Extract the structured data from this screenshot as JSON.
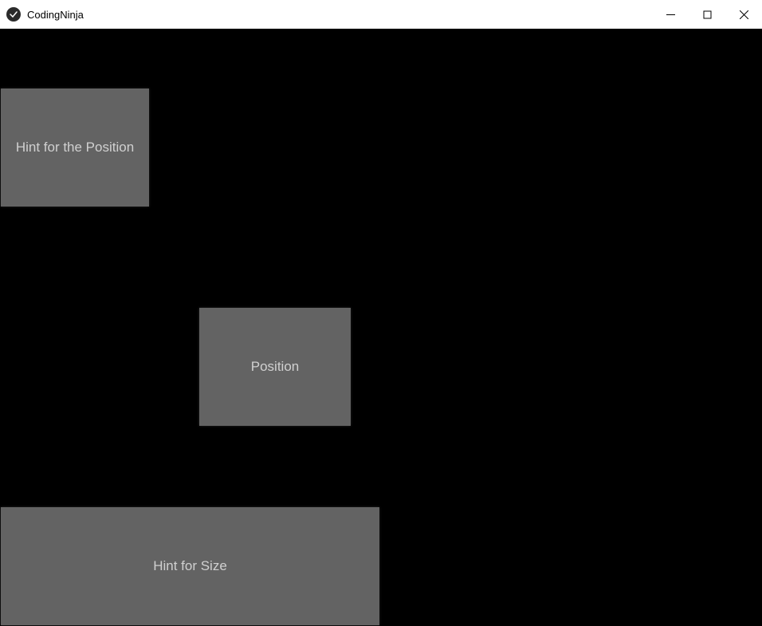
{
  "window": {
    "title": "CodingNinja"
  },
  "buttons": {
    "hint_position_label": "Hint for the Position",
    "position_label": "Position",
    "hint_size_label": "Hint for Size"
  }
}
